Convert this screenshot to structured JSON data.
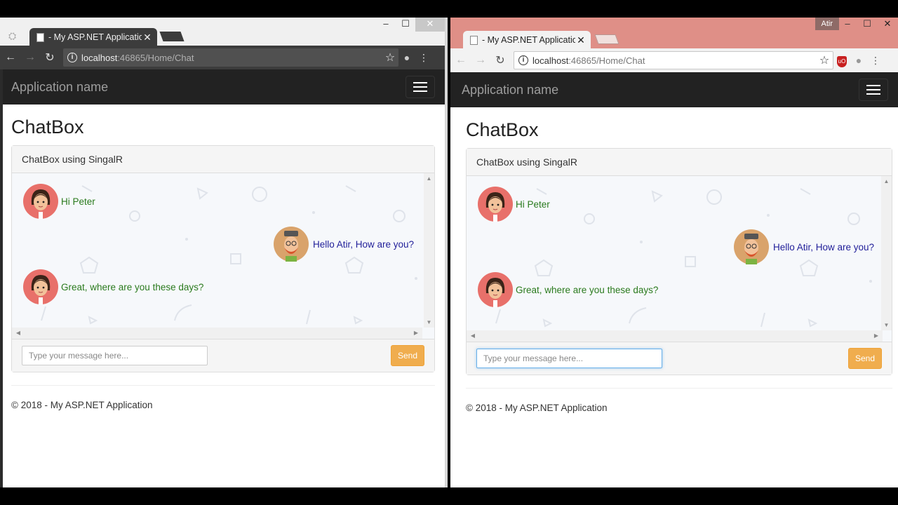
{
  "colors": {
    "left_chrome": "#3c3c3c",
    "right_chrome": "#df8f87",
    "navbar": "#222222",
    "send_button": "#f0ad4e",
    "left_msg_text": "#2a7a1d",
    "right_msg_text": "#22209a"
  },
  "left_window": {
    "tab_title": "- My ASP.NET Applicatio",
    "tab_close": "✕",
    "url_host": "localhost",
    "url_path": ":46865/Home/Chat",
    "win_controls": [
      "–",
      "☐",
      "✕"
    ]
  },
  "right_window": {
    "user_badge": "Atir",
    "tab_title": "- My ASP.NET Applicatio",
    "tab_close": "✕",
    "url_host": "localhost",
    "url_path": ":46865/Home/Chat",
    "win_controls": [
      "–",
      "☐",
      "✕"
    ]
  },
  "app": {
    "brand": "Application name",
    "page_title": "ChatBox",
    "panel_heading": "ChatBox using SingalR",
    "input_placeholder": "Type your message here...",
    "send_label": "Send",
    "footer": "© 2018 - My ASP.NET Application"
  },
  "messages": [
    {
      "sender": "girl-avatar",
      "side": "left",
      "text": "Hi Peter"
    },
    {
      "sender": "hipster-avatar",
      "side": "right",
      "text": "Hello Atir, How are you?"
    },
    {
      "sender": "girl-avatar",
      "side": "left",
      "text": "Great, where are you these days?"
    }
  ],
  "icons": [
    "back-arrow-icon",
    "forward-arrow-icon",
    "reload-icon",
    "info-icon",
    "star-icon",
    "extension-icon",
    "menu-dots-icon",
    "hamburger-icon",
    "document-icon"
  ]
}
